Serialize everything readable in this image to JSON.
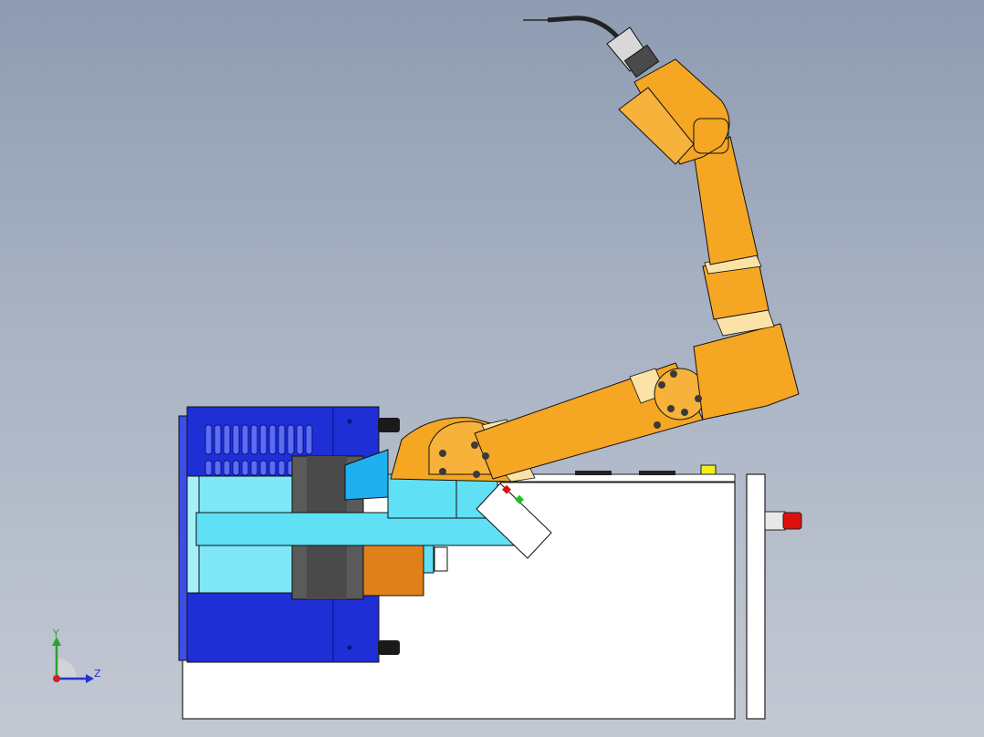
{
  "view": {
    "type": "cad-model-viewport",
    "background": "gradient",
    "background_top": "#8e9bb1",
    "background_bottom": "#c3c9d3"
  },
  "triad": {
    "y_label": "Y",
    "z_label": "Z",
    "colors": {
      "y": "#2ea02e",
      "z": "#2233cc",
      "x": "#cc2222"
    }
  },
  "model": {
    "robot_color": "#f5a623",
    "robot_highlight": "#fbe3a8",
    "positioner_blue": "#1e2fd6",
    "cyan": "#5fe0f5",
    "base_fill": "#ffffff",
    "stop_button": "#e01010",
    "joint_bolt": "#3a3a3a"
  }
}
